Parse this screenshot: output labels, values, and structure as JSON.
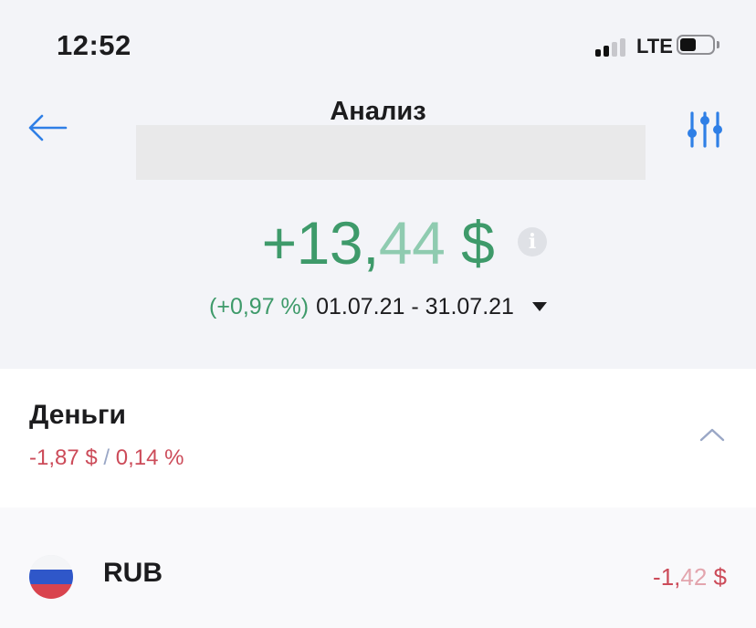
{
  "status_bar": {
    "time": "12:52",
    "network": "LTE",
    "signal_bars_active": 2,
    "signal_bars_total": 4
  },
  "nav": {
    "title": "Анализ",
    "back_icon": "arrow-left-icon",
    "filter_icon": "sliders-icon"
  },
  "summary": {
    "amount_main": "+13,",
    "amount_fraction": "44",
    "amount_currency": " $",
    "percent": "(+0,97 %)",
    "period": "01.07.21 - 31.07.21",
    "info_icon": "info-icon",
    "caret_icon": "caret-down-icon"
  },
  "money": {
    "title": "Деньги",
    "change_amount": "-1,87 $",
    "separator": " / ",
    "change_percent": "0,14 %",
    "collapse_icon": "chevron-up-icon"
  },
  "currencies": [
    {
      "code": "RUB",
      "value_main": "-1,",
      "value_fraction": "42",
      "value_currency": " $",
      "flag_icon": "russia-flag-icon"
    }
  ],
  "colors": {
    "positive": "#3e9a6a",
    "positive_light": "#8fcbb0",
    "negative": "#cc4b59",
    "accent": "#2f7fe6"
  }
}
